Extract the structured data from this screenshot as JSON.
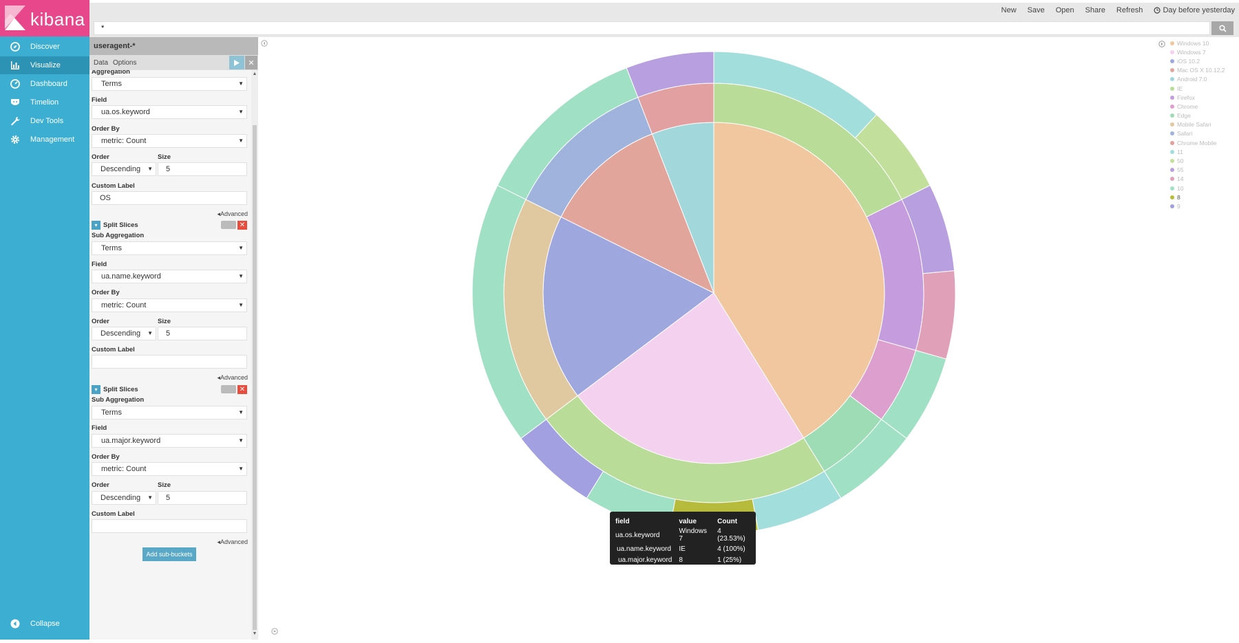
{
  "nav": {
    "brand": "kibana",
    "items": [
      {
        "label": "Discover"
      },
      {
        "label": "Visualize"
      },
      {
        "label": "Dashboard"
      },
      {
        "label": "Timelion"
      },
      {
        "label": "Dev Tools"
      },
      {
        "label": "Management"
      }
    ],
    "collapse": "Collapse",
    "active": "Visualize"
  },
  "topbar": {
    "new": "New",
    "save": "Save",
    "open": "Open",
    "share": "Share",
    "refresh": "Refresh",
    "time": "Day before yesterday"
  },
  "search": {
    "value": "*"
  },
  "editor": {
    "index": "useragent-*",
    "tabs": [
      "Data",
      "Options"
    ],
    "bucket1": {
      "agg_label": "Aggregation",
      "agg_value": "Terms",
      "field_label": "Field",
      "field_value": "ua.os.keyword",
      "orderby_label": "Order By",
      "orderby_value": "metric: Count",
      "order_label": "Order",
      "order_value": "Descending",
      "size_label": "Size",
      "size_value": "5",
      "custom_label": "Custom Label",
      "custom_value": "OS",
      "advanced": "Advanced"
    },
    "bucket2": {
      "title": "Split Slices",
      "agg_label": "Sub Aggregation",
      "agg_value": "Terms",
      "field_label": "Field",
      "field_value": "ua.name.keyword",
      "orderby_label": "Order By",
      "orderby_value": "metric: Count",
      "order_label": "Order",
      "order_value": "Descending",
      "size_label": "Size",
      "size_value": "5",
      "custom_label": "Custom Label",
      "custom_value": "",
      "advanced": "Advanced"
    },
    "bucket3": {
      "title": "Split Slices",
      "agg_label": "Sub Aggregation",
      "agg_value": "Terms",
      "field_label": "Field",
      "field_value": "ua.major.keyword",
      "orderby_label": "Order By",
      "orderby_value": "metric: Count",
      "order_label": "Order",
      "order_value": "Descending",
      "size_label": "Size",
      "size_value": "5",
      "custom_label": "Custom Label",
      "custom_value": "",
      "advanced": "Advanced"
    },
    "add_button": "Add sub-buckets"
  },
  "legend": [
    {
      "label": "Windows 10",
      "color": "#f1c7a0"
    },
    {
      "label": "Windows 7",
      "color": "#f3d1ef"
    },
    {
      "label": "iOS 10.2",
      "color": "#9fa7df"
    },
    {
      "label": "Mac OS X 10.12.2",
      "color": "#e2a59c"
    },
    {
      "label": "Android 7.0",
      "color": "#a2d8dc"
    },
    {
      "label": "IE",
      "color": "#b9dd99"
    },
    {
      "label": "Firefox",
      "color": "#c59cdd"
    },
    {
      "label": "Chrome",
      "color": "#dd9fce"
    },
    {
      "label": "Edge",
      "color": "#9ddcb4"
    },
    {
      "label": "Mobile Safari",
      "color": "#e0c8a0"
    },
    {
      "label": "Safari",
      "color": "#9fb3dd"
    },
    {
      "label": "Chrome Mobile",
      "color": "#e2a0a0"
    },
    {
      "label": "11",
      "color": "#a2dedc"
    },
    {
      "label": "50",
      "color": "#c2e09c"
    },
    {
      "label": "55",
      "color": "#b8a0e0"
    },
    {
      "label": "14",
      "color": "#e0a0b8"
    },
    {
      "label": "10",
      "color": "#a0e0c4"
    },
    {
      "label": "8",
      "color": "#b6bb3c"
    },
    {
      "label": "9",
      "color": "#a2a0e0"
    }
  ],
  "chart_data": {
    "type": "pie",
    "rings": [
      {
        "name": "ua.os.keyword",
        "slices": [
          {
            "label": "Windows 10",
            "value": 7
          },
          {
            "label": "Windows 7",
            "value": 4
          },
          {
            "label": "iOS 10.2",
            "value": 3
          },
          {
            "label": "Mac OS X 10.12.2",
            "value": 2
          },
          {
            "label": "Android 7.0",
            "value": 1
          }
        ]
      },
      {
        "name": "ua.name.keyword",
        "slices": [
          {
            "label": "IE",
            "value": 3,
            "parent": "Windows 10"
          },
          {
            "label": "Firefox",
            "value": 2,
            "parent": "Windows 10"
          },
          {
            "label": "Chrome",
            "value": 1,
            "parent": "Windows 10"
          },
          {
            "label": "Edge",
            "value": 1,
            "parent": "Windows 10"
          },
          {
            "label": "IE",
            "value": 4,
            "parent": "Windows 7"
          },
          {
            "label": "Mobile Safari",
            "value": 3,
            "parent": "iOS 10.2"
          },
          {
            "label": "Safari",
            "value": 2,
            "parent": "Mac OS X 10.12.2"
          },
          {
            "label": "Chrome Mobile",
            "value": 1,
            "parent": "Android 7.0"
          }
        ]
      },
      {
        "name": "ua.major.keyword",
        "slices": [
          {
            "label": "11",
            "value": 2,
            "parent": "IE"
          },
          {
            "label": "50",
            "value": 1,
            "parent": "IE"
          },
          {
            "label": "55",
            "value": 1,
            "parent": "Firefox"
          },
          {
            "label": "14",
            "value": 1,
            "parent": "Firefox"
          },
          {
            "label": "10",
            "value": 1,
            "parent": "Chrome"
          },
          {
            "label": "10",
            "value": 1,
            "parent": "Edge"
          },
          {
            "label": "11",
            "value": 1,
            "parent": "IE"
          },
          {
            "label": "8",
            "value": 1,
            "parent": "IE"
          },
          {
            "label": "10",
            "value": 1,
            "parent": "IE"
          },
          {
            "label": "9",
            "value": 1,
            "parent": "IE"
          },
          {
            "label": "10",
            "value": 3,
            "parent": "Mobile Safari"
          },
          {
            "label": "10",
            "value": 2,
            "parent": "Safari"
          },
          {
            "label": "55",
            "value": 1,
            "parent": "Chrome Mobile"
          }
        ]
      }
    ]
  },
  "tooltip": {
    "headers": [
      "field",
      "value",
      "Count"
    ],
    "rows": [
      [
        "ua.os.keyword",
        "Windows 7",
        "4 (23.53%)"
      ],
      [
        "ua.name.keyword",
        "IE",
        "4 (100%)"
      ],
      [
        "ua.major.keyword",
        "8",
        "1 (25%)"
      ]
    ]
  }
}
